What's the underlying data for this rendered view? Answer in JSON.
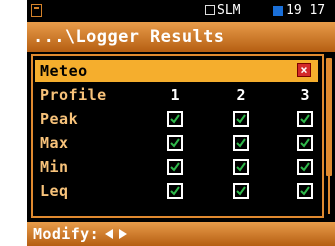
{
  "status": {
    "mode": "SLM",
    "time": "19 17",
    "battery_color": "#1a6fd8"
  },
  "title": "...\\Logger Results",
  "menu": {
    "selected": "Meteo",
    "meteo_value": "×",
    "profile_label": "Profile",
    "columns": [
      "1",
      "2",
      "3"
    ],
    "rows": [
      {
        "label": "Peak",
        "checked": [
          true,
          true,
          true
        ]
      },
      {
        "label": "Max",
        "checked": [
          true,
          true,
          true
        ]
      },
      {
        "label": "Min",
        "checked": [
          true,
          true,
          true
        ]
      },
      {
        "label": "Leq",
        "checked": [
          true,
          true,
          true
        ]
      }
    ]
  },
  "footer": {
    "label": "Modify:",
    "arrows": [
      "arrow-left-icon",
      "arrow-right-icon"
    ]
  },
  "colors": {
    "accent": "#e08a30",
    "highlight": "#f5ae2d",
    "check": "#2fb84a",
    "unchecked_x": "#d42a2a"
  }
}
